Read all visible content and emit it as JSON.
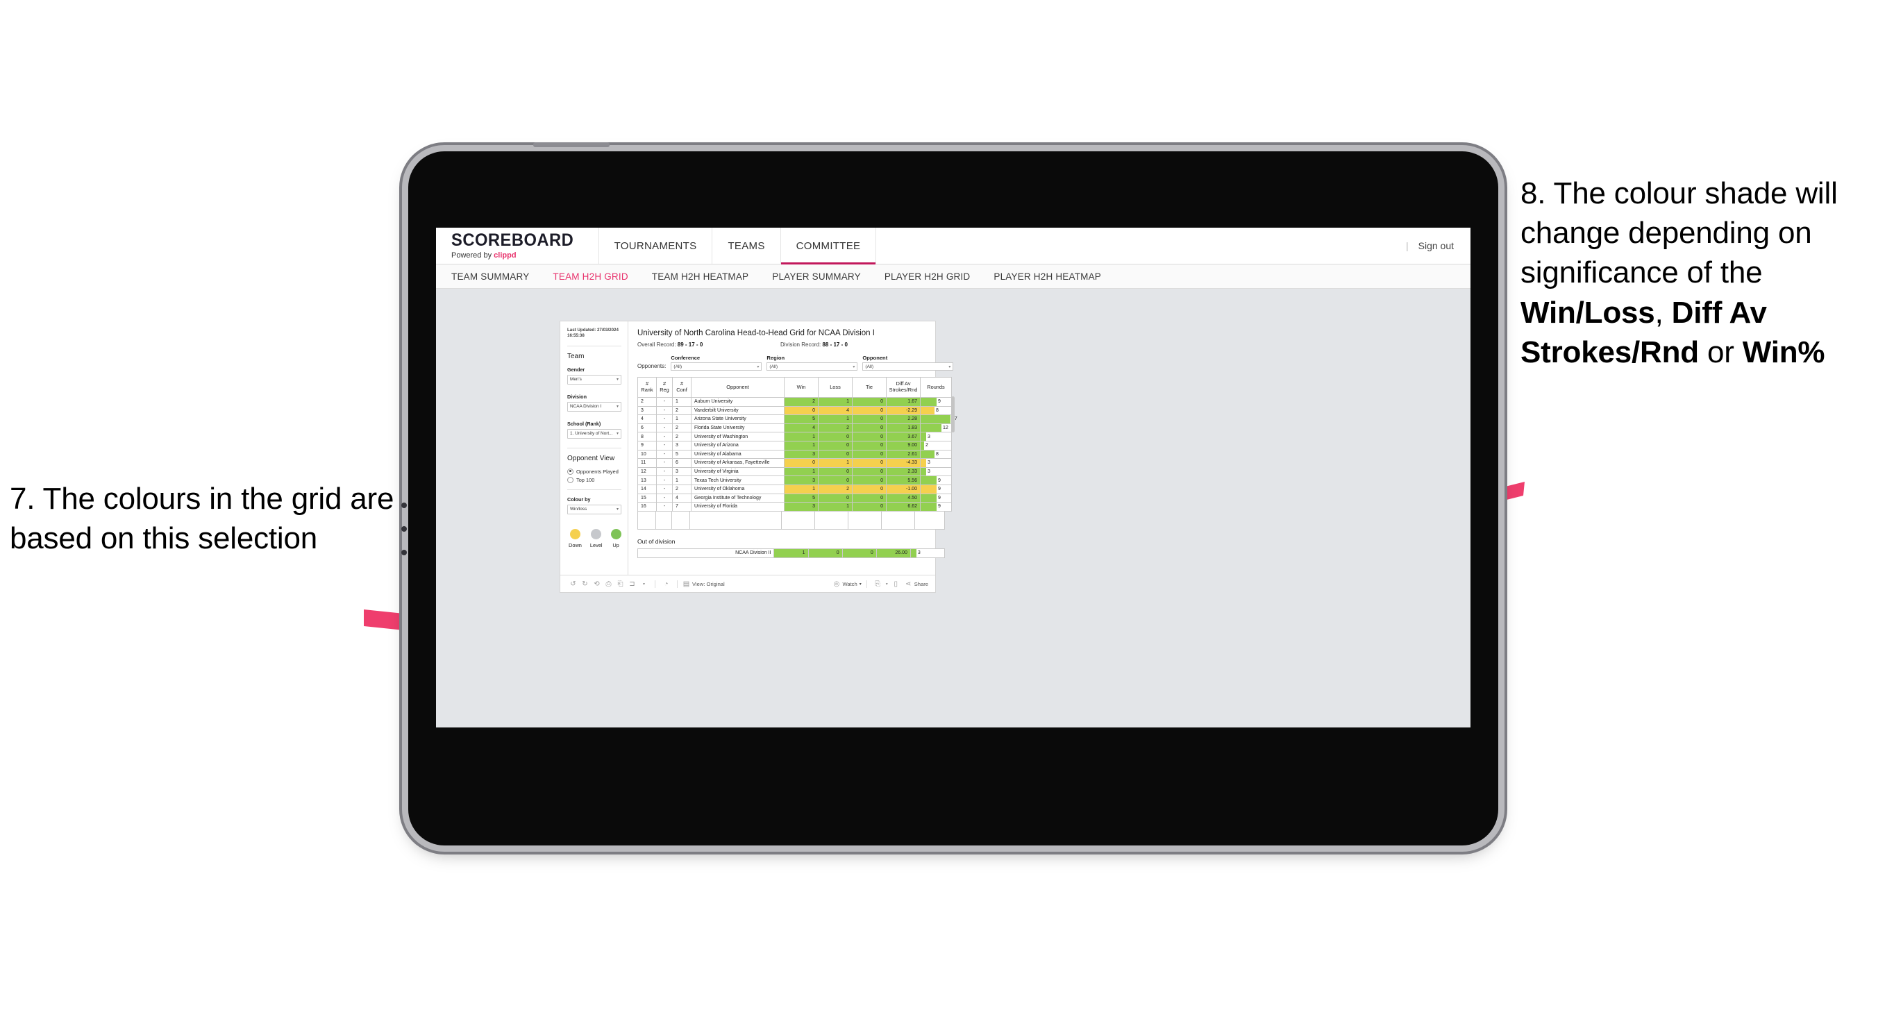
{
  "annotations": {
    "left": {
      "text": "7. The colours in the grid are based on this selection"
    },
    "right": {
      "line1": "8. The colour shade will change depending on significance of the ",
      "bold1": "Win/Loss",
      "sep1": ", ",
      "bold2": "Diff Av Strokes/Rnd",
      "sep2": " or ",
      "bold3": "Win%",
      "arrow_color": "#e8336d"
    }
  },
  "app": {
    "brand": {
      "logo": "SCOREBOARD",
      "powered_prefix": "Powered by ",
      "powered_name": "clippd"
    },
    "topnav": [
      {
        "label": "TOURNAMENTS",
        "active": false
      },
      {
        "label": "TEAMS",
        "active": false
      },
      {
        "label": "COMMITTEE",
        "active": true
      }
    ],
    "signout": {
      "divider": "|",
      "label": "Sign out"
    },
    "subnav": [
      {
        "label": "TEAM SUMMARY",
        "active": false
      },
      {
        "label": "TEAM H2H GRID",
        "active": true
      },
      {
        "label": "TEAM H2H HEATMAP",
        "active": false
      },
      {
        "label": "PLAYER SUMMARY",
        "active": false
      },
      {
        "label": "PLAYER H2H GRID",
        "active": false
      },
      {
        "label": "PLAYER H2H HEATMAP",
        "active": false
      }
    ],
    "accent": "#e8336d"
  },
  "sidebar": {
    "last_updated": "Last Updated: 27/03/2024 16:55:38",
    "team_heading": "Team",
    "gender": {
      "label": "Gender",
      "value": "Men's"
    },
    "division": {
      "label": "Division",
      "value": "NCAA Division I"
    },
    "school": {
      "label": "School (Rank)",
      "value": "1. University of Nort..."
    },
    "opponent_view": {
      "heading": "Opponent View",
      "options": [
        {
          "label": "Opponents Played",
          "selected": true
        },
        {
          "label": "Top 100",
          "selected": false
        }
      ]
    },
    "colour_by": {
      "label": "Colour by",
      "value": "Win/loss"
    },
    "legend": [
      {
        "label": "Down",
        "color": "#f5d04e"
      },
      {
        "label": "Level",
        "color": "#c6c8cc"
      },
      {
        "label": "Up",
        "color": "#7ec356"
      }
    ]
  },
  "main": {
    "title": "University of North Carolina Head-to-Head Grid for NCAA Division I",
    "overall_record_label": "Overall Record: ",
    "overall_record_value": "89 - 17 - 0",
    "division_record_label": "Division Record: ",
    "division_record_value": "88 - 17 - 0",
    "opponents_label": "Opponents:",
    "filters": [
      {
        "label": "Conference",
        "value": "(All)"
      },
      {
        "label": "Region",
        "value": "(All)"
      },
      {
        "label": "Opponent",
        "value": "(All)"
      }
    ],
    "out_of_division_title": "Out of division"
  },
  "chart_data": {
    "type": "table",
    "title": "University of North Carolina Head-to-Head Grid for NCAA Division I",
    "columns": [
      "# Rank",
      "# Reg",
      "# Conf",
      "Opponent",
      "Win",
      "Loss",
      "Tie",
      "Diff Av Strokes/Rnd",
      "Rounds"
    ],
    "column_headers_multiline": [
      [
        "#",
        "Rank"
      ],
      [
        "#",
        "Reg"
      ],
      [
        "#",
        "Conf"
      ],
      [
        "",
        "Opponent"
      ],
      [
        "",
        "Win"
      ],
      [
        "",
        "Loss"
      ],
      [
        "",
        "Tie"
      ],
      [
        "Diff Av",
        "Strokes/Rnd"
      ],
      [
        "",
        "Rounds"
      ]
    ],
    "rounds_max": 17,
    "colors": {
      "up": "#92d050",
      "down": "#f5d04e",
      "level": "#c6c8cc"
    },
    "rows": [
      {
        "rank": "2",
        "reg": "-",
        "conf": "1",
        "opponent": "Auburn University",
        "win": "2",
        "loss": "1",
        "tie": "0",
        "diff": "1.67",
        "rounds": 9,
        "state": "up"
      },
      {
        "rank": "3",
        "reg": "-",
        "conf": "2",
        "opponent": "Vanderbilt University",
        "win": "0",
        "loss": "4",
        "tie": "0",
        "diff": "-2.29",
        "rounds": 8,
        "state": "down"
      },
      {
        "rank": "4",
        "reg": "-",
        "conf": "1",
        "opponent": "Arizona State University",
        "win": "5",
        "loss": "1",
        "tie": "0",
        "diff": "2.28",
        "rounds": 17,
        "state": "up"
      },
      {
        "rank": "6",
        "reg": "-",
        "conf": "2",
        "opponent": "Florida State University",
        "win": "4",
        "loss": "2",
        "tie": "0",
        "diff": "1.83",
        "rounds": 12,
        "state": "up"
      },
      {
        "rank": "8",
        "reg": "-",
        "conf": "2",
        "opponent": "University of Washington",
        "win": "1",
        "loss": "0",
        "tie": "0",
        "diff": "3.67",
        "rounds": 3,
        "state": "up"
      },
      {
        "rank": "9",
        "reg": "-",
        "conf": "3",
        "opponent": "University of Arizona",
        "win": "1",
        "loss": "0",
        "tie": "0",
        "diff": "9.00",
        "rounds": 2,
        "state": "up"
      },
      {
        "rank": "10",
        "reg": "-",
        "conf": "5",
        "opponent": "University of Alabama",
        "win": "3",
        "loss": "0",
        "tie": "0",
        "diff": "2.61",
        "rounds": 8,
        "state": "up"
      },
      {
        "rank": "11",
        "reg": "-",
        "conf": "6",
        "opponent": "University of Arkansas, Fayetteville",
        "win": "0",
        "loss": "1",
        "tie": "0",
        "diff": "-4.33",
        "rounds": 3,
        "state": "down"
      },
      {
        "rank": "12",
        "reg": "-",
        "conf": "3",
        "opponent": "University of Virginia",
        "win": "1",
        "loss": "0",
        "tie": "0",
        "diff": "2.33",
        "rounds": 3,
        "state": "up"
      },
      {
        "rank": "13",
        "reg": "-",
        "conf": "1",
        "opponent": "Texas Tech University",
        "win": "3",
        "loss": "0",
        "tie": "0",
        "diff": "5.56",
        "rounds": 9,
        "state": "up"
      },
      {
        "rank": "14",
        "reg": "-",
        "conf": "2",
        "opponent": "University of Oklahoma",
        "win": "1",
        "loss": "2",
        "tie": "0",
        "diff": "-1.00",
        "rounds": 9,
        "state": "down"
      },
      {
        "rank": "15",
        "reg": "-",
        "conf": "4",
        "opponent": "Georgia Institute of Technology",
        "win": "5",
        "loss": "0",
        "tie": "0",
        "diff": "4.50",
        "rounds": 9,
        "state": "up"
      },
      {
        "rank": "16",
        "reg": "-",
        "conf": "7",
        "opponent": "University of Florida",
        "win": "3",
        "loss": "1",
        "tie": "0",
        "diff": "6.62",
        "rounds": 9,
        "state": "up"
      }
    ],
    "out_of_division_rows": [
      {
        "opponent": "NCAA Division II",
        "win": "1",
        "loss": "0",
        "tie": "0",
        "diff": "26.00",
        "rounds": 3,
        "state": "up"
      }
    ]
  },
  "toolbar": {
    "icons": [
      "undo-icon",
      "redo-icon",
      "revert-icon",
      "refresh-icon",
      "pause-icon",
      "loop-icon",
      "caret-down-icon",
      "history-icon"
    ],
    "view_label": "View: Original",
    "watch_label": "Watch",
    "share_label": "Share"
  }
}
